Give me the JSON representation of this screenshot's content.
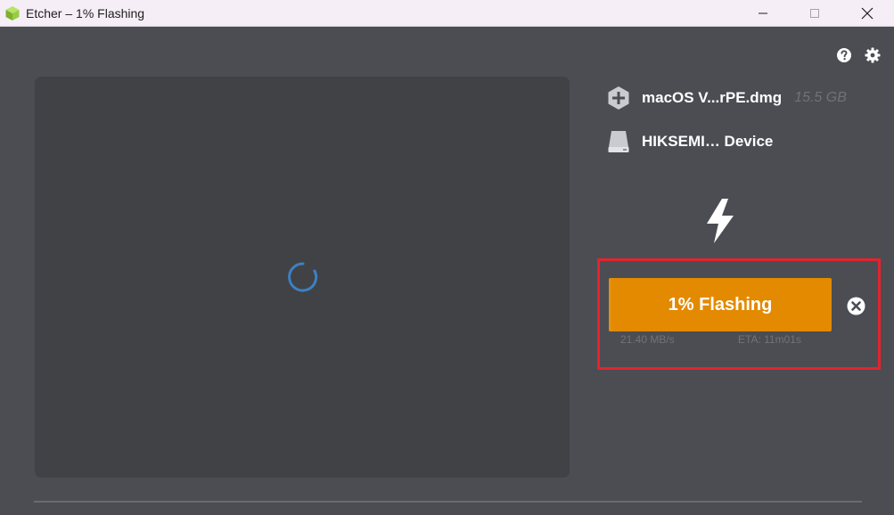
{
  "window": {
    "title": "Etcher – 1% Flashing",
    "app_icon": "etcher-cube-icon",
    "controls": [
      "minimize-icon",
      "maximize-icon",
      "close-icon"
    ]
  },
  "toolbar": {
    "icons": [
      "help-icon",
      "settings-gear-icon"
    ]
  },
  "image": {
    "name": "macOS V...rPE.dmg",
    "size": "15.5 GB",
    "icon": "plus-hexagon-icon"
  },
  "drive": {
    "name": "HIKSEMI… Device",
    "icon": "drive-icon"
  },
  "flash": {
    "icon": "lightning-bolt-icon",
    "status_label": "1% Flashing",
    "percent": 1,
    "speed": "21.40 MB/s",
    "eta": "ETA: 11m01s",
    "cancel_icon": "cancel-x-icon"
  },
  "colors": {
    "background": "#4b4d53",
    "preview": "#414245",
    "accent": "#e38a00",
    "highlight": "#e6222c",
    "spinner": "#3d80c4"
  }
}
